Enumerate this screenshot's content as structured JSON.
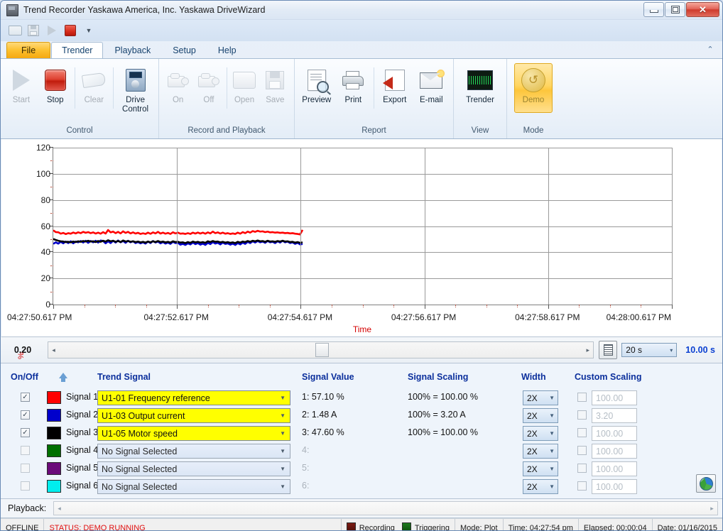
{
  "window": {
    "title": "Trend Recorder Yaskawa America, Inc. Yaskawa DriveWizard",
    "icon": "app-icon",
    "minimize": "–",
    "maximize": "□",
    "close": "✕"
  },
  "quick_access": {
    "items": [
      {
        "name": "open-icon",
        "label": "Open"
      },
      {
        "name": "save-icon",
        "label": "Save"
      },
      {
        "name": "play-icon",
        "label": "Start"
      },
      {
        "name": "stop-icon",
        "label": "Stop"
      },
      {
        "name": "customize-icon",
        "label": "▾"
      }
    ]
  },
  "tabs": [
    {
      "label": "File",
      "state": "file"
    },
    {
      "label": "Trender",
      "state": "active"
    },
    {
      "label": "Playback",
      "state": "normal"
    },
    {
      "label": "Setup",
      "state": "normal"
    },
    {
      "label": "Help",
      "state": "normal"
    }
  ],
  "ribbon": {
    "collapse_glyph": "⌃",
    "groups": [
      {
        "label": "Control",
        "buttons": [
          {
            "label": "Start",
            "icon": "play-icon",
            "enabled": false
          },
          {
            "label": "Stop",
            "icon": "stop-icon",
            "enabled": true
          },
          {
            "label": "Clear",
            "icon": "eraser-icon",
            "enabled": false
          },
          {
            "label": "Drive Control",
            "icon": "drive-control-icon",
            "enabled": true
          }
        ]
      },
      {
        "label": "Record and Playback",
        "buttons": [
          {
            "label": "On",
            "icon": "camcorder-on-icon",
            "enabled": false
          },
          {
            "label": "Off",
            "icon": "camcorder-off-icon",
            "enabled": false
          },
          {
            "label": "Open",
            "icon": "folder-open-icon",
            "enabled": false
          },
          {
            "label": "Save",
            "icon": "floppy-save-icon",
            "enabled": false
          }
        ]
      },
      {
        "label": "Report",
        "buttons": [
          {
            "label": "Preview",
            "icon": "print-preview-icon",
            "enabled": true
          },
          {
            "label": "Print",
            "icon": "printer-icon",
            "enabled": true
          },
          {
            "label": "Export",
            "icon": "export-icon",
            "enabled": true
          },
          {
            "label": "E-mail",
            "icon": "email-icon",
            "enabled": true
          }
        ]
      },
      {
        "label": "View",
        "buttons": [
          {
            "label": "Trender",
            "icon": "trender-scope-icon",
            "enabled": true
          }
        ]
      },
      {
        "label": "Mode",
        "buttons": [
          {
            "label": "Demo",
            "icon": "demo-mode-icon",
            "enabled": true,
            "selected": true
          }
        ]
      }
    ]
  },
  "chart_data": {
    "type": "line",
    "title": "",
    "xlabel": "Time",
    "ylabel": "%",
    "ylim": [
      0,
      120
    ],
    "yticks": [
      0,
      20,
      40,
      60,
      80,
      100,
      120
    ],
    "grid": true,
    "legend_position": "table-below",
    "x_tick_labels": [
      "04:27:50.617 PM",
      "04:27:52.617 PM",
      "04:27:54.617 PM",
      "04:27:56.617 PM",
      "04:27:58.617 PM",
      "04:28:00.617 PM"
    ],
    "x_range_seconds": [
      0,
      10
    ],
    "data_end_fraction": 0.403,
    "series": [
      {
        "name": "Signal 1: U1-01 Frequency reference",
        "color": "#ff0000",
        "values": [
          56.8,
          55.4,
          55.3,
          54.2,
          54.8,
          53.9,
          54.6,
          54.2,
          55.1,
          54.4,
          55.3,
          54.6,
          55.6,
          54.9,
          55.4,
          54.6,
          55.2,
          54.3,
          55.0,
          54.2,
          55.4,
          54.3,
          57.0,
          55.2,
          55.8,
          54.6,
          55.6,
          54.4,
          56.0,
          54.8,
          55.6,
          54.4,
          55.2,
          54.3,
          54.9,
          54.0,
          54.5,
          54.0,
          55.0,
          54.1,
          55.2,
          54.4,
          55.6,
          54.3,
          55.0,
          54.2,
          54.8,
          54.0,
          55.3,
          54.4,
          55.0,
          54.2,
          54.4,
          54.0,
          54.6,
          54.0,
          55.0,
          54.3,
          55.1,
          54.3,
          55.0,
          54.2,
          55.2,
          54.4,
          55.8,
          54.6,
          55.2,
          54.3,
          55.0,
          54.2,
          54.6,
          54.0,
          54.4,
          54.0,
          55.0,
          54.2,
          55.4,
          54.6,
          55.8,
          55.0,
          56.2,
          55.6,
          56.4,
          55.8,
          56.0,
          55.4,
          55.8,
          55.2,
          55.4,
          55.0,
          55.2,
          54.8,
          55.0,
          54.6,
          54.8,
          54.4,
          54.6,
          54.2,
          54.0,
          53.6,
          57.1
        ]
      },
      {
        "name": "Signal 2: U1-03 Output current",
        "color": "#0000cc",
        "values": [
          46.4,
          47.6,
          46.6,
          48.0,
          46.8,
          48.2,
          47.0,
          48.4,
          46.8,
          48.2,
          47.6,
          48.6,
          47.4,
          48.8,
          47.2,
          48.6,
          47.6,
          48.8,
          47.4,
          49.0,
          48.6,
          46.8,
          48.4,
          47.0,
          48.8,
          47.4,
          49.0,
          47.6,
          48.6,
          47.2,
          48.8,
          47.6,
          48.4,
          47.0,
          47.8,
          46.8,
          47.6,
          46.6,
          48.2,
          47.0,
          48.6,
          47.4,
          48.2,
          46.8,
          47.8,
          46.6,
          47.4,
          46.4,
          48.0,
          47.0,
          47.2,
          45.8,
          46.4,
          45.6,
          46.8,
          46.0,
          47.4,
          46.2,
          47.0,
          45.8,
          46.6,
          45.6,
          47.2,
          46.2,
          47.8,
          46.6,
          47.2,
          46.0,
          47.4,
          46.4,
          46.8,
          45.8,
          46.6,
          45.6,
          47.0,
          46.0,
          47.4,
          46.4,
          48.0,
          47.0,
          48.4,
          47.4,
          48.6,
          47.6,
          48.2,
          47.2,
          48.6,
          47.6,
          48.0,
          47.0,
          48.4,
          47.4,
          48.8,
          47.6,
          48.2,
          47.0,
          47.6,
          46.4,
          47.2,
          46.0,
          46.3
        ]
      },
      {
        "name": "Signal 3: U1-05 Motor speed",
        "color": "#000000",
        "values": [
          50.2,
          49.4,
          48.8,
          48.4,
          48.2,
          47.8,
          48.0,
          47.6,
          48.2,
          47.8,
          48.4,
          48.0,
          48.6,
          48.2,
          48.8,
          48.2,
          48.4,
          47.8,
          48.6,
          48.0,
          48.8,
          48.2,
          49.2,
          48.4,
          48.8,
          48.0,
          48.6,
          47.8,
          49.0,
          48.2,
          48.6,
          48.0,
          48.4,
          47.8,
          48.2,
          47.6,
          48.0,
          47.4,
          48.2,
          47.6,
          48.4,
          47.8,
          48.6,
          47.8,
          48.2,
          47.6,
          48.0,
          47.4,
          48.4,
          47.8,
          48.0,
          47.4,
          47.6,
          47.0,
          47.8,
          47.2,
          48.2,
          47.6,
          48.0,
          47.4,
          47.8,
          47.2,
          48.4,
          47.8,
          48.6,
          48.0,
          48.2,
          47.6,
          48.0,
          47.4,
          47.8,
          47.2,
          47.6,
          47.0,
          48.0,
          47.4,
          48.2,
          47.8,
          48.6,
          48.0,
          48.8,
          48.4,
          49.0,
          48.4,
          48.6,
          48.0,
          48.8,
          48.2,
          48.4,
          48.0,
          48.6,
          48.2,
          48.8,
          48.2,
          48.4,
          47.8,
          48.0,
          47.4,
          47.8,
          47.2,
          47.6
        ]
      }
    ]
  },
  "timebar": {
    "left_value": "0.20",
    "scroll_left_glyph": "◂",
    "scroll_right_glyph": "▸",
    "list_button": "list-view-button",
    "duration_select": "20 s",
    "duration_caret": "▾",
    "elapsed_display": "10.00 s"
  },
  "signal_table": {
    "headers": {
      "onoff": "On/Off",
      "sort": "sort-ascending-icon",
      "trend_signal": "Trend Signal",
      "signal_value": "Signal Value",
      "signal_scaling": "Signal Scaling",
      "width": "Width",
      "custom_scaling": "Custom Scaling"
    },
    "rows": [
      {
        "checked": true,
        "color": "#ff0000",
        "label": "Signal 1:",
        "signal": "U1-01 Frequency reference",
        "value": "1: 57.10 %",
        "scaling": "100% = 100.00 %",
        "width": "2X",
        "custom": "100.00",
        "custom_enabled": true
      },
      {
        "checked": true,
        "color": "#0000cc",
        "label": "Signal 2:",
        "signal": "U1-03 Output current",
        "value": "2: 1.48 A",
        "scaling": "100% = 3.20 A",
        "width": "2X",
        "custom": "3.20",
        "custom_enabled": true
      },
      {
        "checked": true,
        "color": "#000000",
        "label": "Signal 3:",
        "signal": "U1-05 Motor speed",
        "value": "3: 47.60 %",
        "scaling": "100% = 100.00 %",
        "width": "2X",
        "custom": "100.00",
        "custom_enabled": true
      },
      {
        "checked": false,
        "color": "#007000",
        "label": "Signal 4:",
        "signal": "No Signal Selected",
        "value": "4:",
        "scaling": "",
        "width": "2X",
        "custom": "100.00",
        "custom_enabled": false
      },
      {
        "checked": false,
        "color": "#6b0a7a",
        "label": "Signal 5:",
        "signal": "No Signal Selected",
        "value": "5:",
        "scaling": "",
        "width": "2X",
        "custom": "100.00",
        "custom_enabled": false
      },
      {
        "checked": false,
        "color": "#00eeee",
        "label": "Signal 6:",
        "signal": "No Signal Selected",
        "value": "6:",
        "scaling": "",
        "width": "2X",
        "custom": "100.00",
        "custom_enabled": false
      }
    ],
    "globe_button": "globe-icon"
  },
  "playback": {
    "label": "Playback:",
    "scroll_left_glyph": "◂",
    "scroll_right_glyph": "▸"
  },
  "statusbar": {
    "connection": "OFFLINE",
    "status": "STATUS: DEMO RUNNING",
    "recording": "Recording",
    "triggering": "Triggering",
    "mode": "Mode: Plot",
    "time": "Time: 04:27:54 pm",
    "elapsed": "Elapsed: 00:00:04",
    "date": "Date: 01/16/2015"
  },
  "colors": {
    "accent_orange": "#fcc02e",
    "header_blue": "#0b2f9c",
    "axis_red": "#d40000",
    "status_red": "#e01010",
    "combo_yellow": "#ffff00"
  }
}
